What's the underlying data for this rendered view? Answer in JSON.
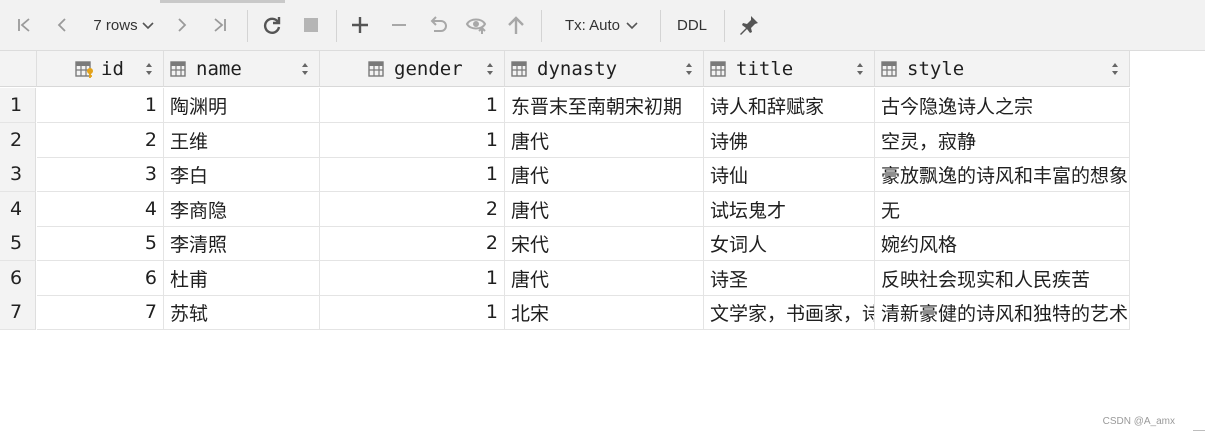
{
  "toolbar": {
    "rows_label": "7 rows",
    "tx_label": "Tx: Auto",
    "ddl_label": "DDL"
  },
  "columns": [
    {
      "label": "id",
      "type": "key-column"
    },
    {
      "label": "name",
      "type": "column"
    },
    {
      "label": "gender",
      "type": "column"
    },
    {
      "label": "dynasty",
      "type": "column"
    },
    {
      "label": "title",
      "type": "column"
    },
    {
      "label": "style",
      "type": "column"
    }
  ],
  "rows": [
    {
      "num": "1",
      "id": "1",
      "name": "陶渊明",
      "gender": "1",
      "dynasty": "东晋末至南朝宋初期",
      "title": "诗人和辞赋家",
      "style": "古今隐逸诗人之宗"
    },
    {
      "num": "2",
      "id": "2",
      "name": "王维",
      "gender": "1",
      "dynasty": "唐代",
      "title": "诗佛",
      "style": "空灵，寂静"
    },
    {
      "num": "3",
      "id": "3",
      "name": "李白",
      "gender": "1",
      "dynasty": "唐代",
      "title": "诗仙",
      "style": "豪放飘逸的诗风和丰富的想象"
    },
    {
      "num": "4",
      "id": "4",
      "name": "李商隐",
      "gender": "2",
      "dynasty": "唐代",
      "title": "试坛鬼才",
      "style": "无"
    },
    {
      "num": "5",
      "id": "5",
      "name": "李清照",
      "gender": "2",
      "dynasty": "宋代",
      "title": "女词人",
      "style": "婉约风格"
    },
    {
      "num": "6",
      "id": "6",
      "name": "杜甫",
      "gender": "1",
      "dynasty": "唐代",
      "title": "诗圣",
      "style": "反映社会现实和人民疾苦"
    },
    {
      "num": "7",
      "id": "7",
      "name": "苏轼",
      "gender": "1",
      "dynasty": "北宋",
      "title": "文学家，书画家，诗",
      "style": "清新豪健的诗风和独特的艺术"
    }
  ],
  "watermark": "CSDN @A_amx"
}
